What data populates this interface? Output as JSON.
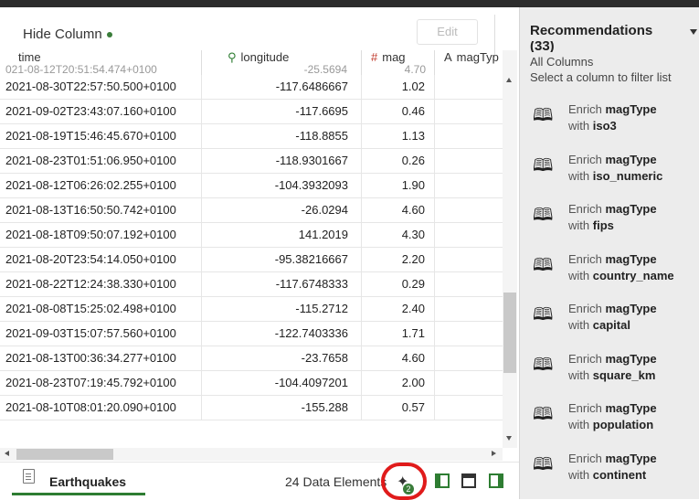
{
  "toolbar": {
    "hide_column": "Hide Column",
    "edit": "Edit"
  },
  "columns": [
    {
      "icon": "clock",
      "label": "time"
    },
    {
      "icon": "location-pin",
      "label": "longitude"
    },
    {
      "icon": "hash",
      "label": "mag"
    },
    {
      "icon": "text-A",
      "label": "magTyp"
    }
  ],
  "partial_row": {
    "time": "021-08-12T20:51:54.474+0100",
    "longitude": "-25.5694",
    "mag": "4.70"
  },
  "rows": [
    {
      "time": "2021-08-30T22:57:50.500+0100",
      "longitude": "-117.6486667",
      "mag": "1.02"
    },
    {
      "time": "2021-09-02T23:43:07.160+0100",
      "longitude": "-117.6695",
      "mag": "0.46"
    },
    {
      "time": "2021-08-19T15:46:45.670+0100",
      "longitude": "-118.8855",
      "mag": "1.13"
    },
    {
      "time": "2021-08-23T01:51:06.950+0100",
      "longitude": "-118.9301667",
      "mag": "0.26"
    },
    {
      "time": "2021-08-12T06:26:02.255+0100",
      "longitude": "-104.3932093",
      "mag": "1.90"
    },
    {
      "time": "2021-08-13T16:50:50.742+0100",
      "longitude": "-26.0294",
      "mag": "4.60"
    },
    {
      "time": "2021-08-18T09:50:07.192+0100",
      "longitude": "141.2019",
      "mag": "4.30"
    },
    {
      "time": "2021-08-20T23:54:14.050+0100",
      "longitude": "-95.38216667",
      "mag": "2.20"
    },
    {
      "time": "2021-08-22T12:24:38.330+0100",
      "longitude": "-117.6748333",
      "mag": "0.29"
    },
    {
      "time": "2021-08-08T15:25:02.498+0100",
      "longitude": "-115.2712",
      "mag": "2.40"
    },
    {
      "time": "2021-09-03T15:07:57.560+0100",
      "longitude": "-122.7403336",
      "mag": "1.71"
    },
    {
      "time": "2021-08-13T00:36:34.277+0100",
      "longitude": "-23.7658",
      "mag": "4.60"
    },
    {
      "time": "2021-08-23T07:19:45.792+0100",
      "longitude": "-104.4097201",
      "mag": "2.00"
    },
    {
      "time": "2021-08-10T08:01:20.090+0100",
      "longitude": "-155.288",
      "mag": "0.57"
    }
  ],
  "footer": {
    "tab": "Earthquakes",
    "elements": "24 Data Elements",
    "badge": "2"
  },
  "panel": {
    "title": "Recommendations",
    "count": "(33)",
    "all_columns": "All Columns",
    "hint": "Select a column to filter list",
    "items": [
      {
        "prefix": "Enrich",
        "column": "magType",
        "with": "with",
        "target": "iso3"
      },
      {
        "prefix": "Enrich",
        "column": "magType",
        "with": "with",
        "target": "iso_numeric"
      },
      {
        "prefix": "Enrich",
        "column": "magType",
        "with": "with",
        "target": "fips"
      },
      {
        "prefix": "Enrich",
        "column": "magType",
        "with": "with",
        "target": "country_name"
      },
      {
        "prefix": "Enrich",
        "column": "magType",
        "with": "with",
        "target": "capital"
      },
      {
        "prefix": "Enrich",
        "column": "magType",
        "with": "with",
        "target": "square_km"
      },
      {
        "prefix": "Enrich",
        "column": "magType",
        "with": "with",
        "target": "population"
      },
      {
        "prefix": "Enrich",
        "column": "magType",
        "with": "with",
        "target": "continent"
      }
    ]
  }
}
